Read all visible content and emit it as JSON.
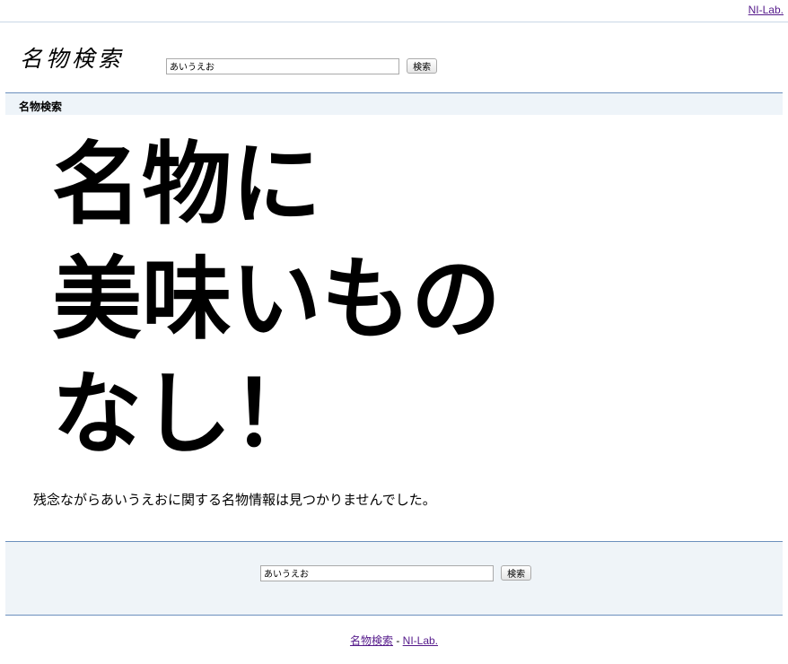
{
  "header": {
    "top_link": "NI-Lab.",
    "logo_text": "名物検索",
    "search_value": "あいうえお",
    "search_button": "検索"
  },
  "section": {
    "title": "名物検索"
  },
  "banner": {
    "line1": "名物に",
    "line2": "美味いもの",
    "line3": "なし！"
  },
  "result": {
    "message": "残念ながらあいうえおに関する名物情報は見つかりませんでした。"
  },
  "footer_search": {
    "value": "あいうえお",
    "button": "検索"
  },
  "footer": {
    "link1": "名物検索",
    "separator": " - ",
    "link2": "NI-Lab."
  }
}
